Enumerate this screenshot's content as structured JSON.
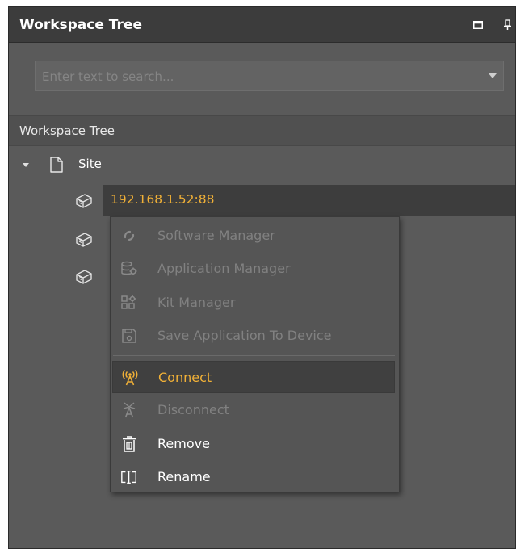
{
  "panel": {
    "title": "Workspace Tree"
  },
  "search": {
    "placeholder": "Enter text to search...",
    "value": ""
  },
  "tree": {
    "header": "Workspace Tree",
    "site": {
      "label": "Site",
      "expanded": true
    },
    "devices": [
      {
        "label": "192.168.1.52:88",
        "selected": true
      },
      {
        "label": ""
      },
      {
        "label": ""
      }
    ]
  },
  "context_menu": {
    "items": [
      {
        "label": "Software Manager",
        "icon": "refresh-icon",
        "enabled": false
      },
      {
        "label": "Application Manager",
        "icon": "database-gear-icon",
        "enabled": false
      },
      {
        "label": "Kit Manager",
        "icon": "grid-gear-icon",
        "enabled": false
      },
      {
        "label": "Save Application To Device",
        "icon": "save-icon",
        "enabled": false
      },
      {
        "label": "Connect",
        "icon": "antenna-icon",
        "enabled": true,
        "highlighted": true
      },
      {
        "label": "Disconnect",
        "icon": "antenna-off-icon",
        "enabled": false
      },
      {
        "label": "Remove",
        "icon": "trash-icon",
        "enabled": true
      },
      {
        "label": "Rename",
        "icon": "rename-icon",
        "enabled": true
      }
    ]
  },
  "colors": {
    "accent": "#f0b037",
    "panel_bg": "#5a5a5a",
    "titlebar_bg": "#3c3c3c",
    "menu_bg": "#555555",
    "disabled_text": "#818181"
  }
}
